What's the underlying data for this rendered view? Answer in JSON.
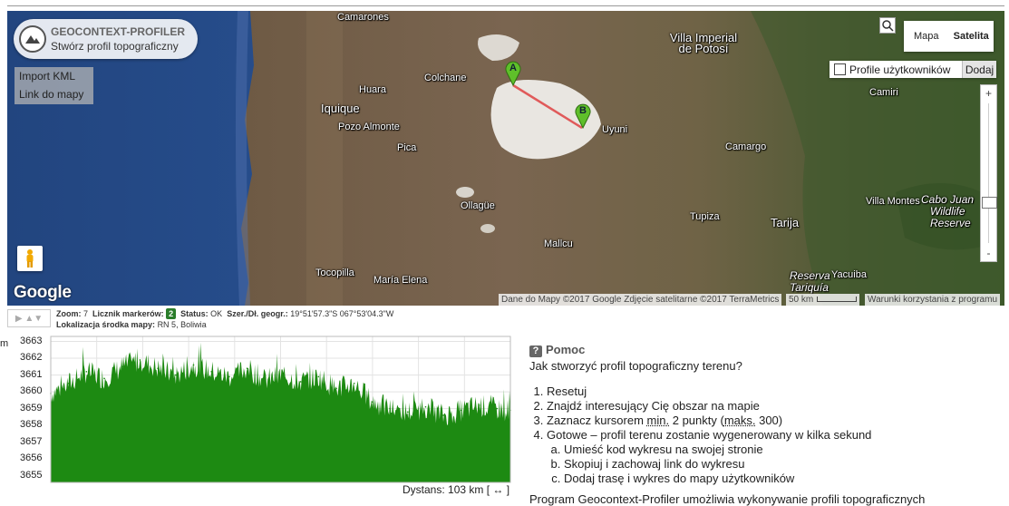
{
  "app": {
    "title": "GEOCONTEXT-PROFILER",
    "subtitle": "Stwórz profil topograficzny"
  },
  "side_links": [
    "Import KML",
    "Link do mapy"
  ],
  "map_type": {
    "map_label": "Mapa",
    "satellite_label": "Satelita",
    "selected": "Satelita"
  },
  "user_profiles": {
    "label": "Profile użytkowników",
    "add_label": "Dodaj",
    "checked": false
  },
  "zoom_controls": {
    "plus": "+",
    "minus": "-",
    "level_fraction": 0.78
  },
  "places": [
    {
      "name": "Camarones",
      "kind": "normal"
    },
    {
      "name": "Villa Imperial de Potosí",
      "kind": "big"
    },
    {
      "name": "Colchane",
      "kind": "normal"
    },
    {
      "name": "Huara",
      "kind": "normal"
    },
    {
      "name": "Iquique",
      "kind": "big"
    },
    {
      "name": "Pozo Almonte",
      "kind": "normal"
    },
    {
      "name": "Pica",
      "kind": "normal"
    },
    {
      "name": "Uyuni",
      "kind": "normal"
    },
    {
      "name": "Camiri",
      "kind": "normal"
    },
    {
      "name": "Camargo",
      "kind": "normal"
    },
    {
      "name": "Ollagüe",
      "kind": "normal"
    },
    {
      "name": "Villa Montes",
      "kind": "normal"
    },
    {
      "name": "Cabo Juan",
      "kind": "italic"
    },
    {
      "name": "Wildlife",
      "kind": "italic"
    },
    {
      "name": "Reserve",
      "kind": "italic"
    },
    {
      "name": "Tupiza",
      "kind": "normal"
    },
    {
      "name": "Tarija",
      "kind": "big"
    },
    {
      "name": "Mallcu",
      "kind": "normal"
    },
    {
      "name": "Tocopilla",
      "kind": "normal"
    },
    {
      "name": "María Elena",
      "kind": "normal"
    },
    {
      "name": "Reserva",
      "kind": "italic"
    },
    {
      "name": "Tariquía",
      "kind": "italic"
    },
    {
      "name": "Yacuiba",
      "kind": "normal"
    }
  ],
  "markers": [
    {
      "label": "A",
      "color": "#4caf1d"
    },
    {
      "label": "B",
      "color": "#4caf1d"
    }
  ],
  "google_logo": "Google",
  "attribution": {
    "data": "Dane do Mapy ©2017 Google Zdjęcie satelitarne ©2017 TerraMetrics",
    "scale": "50 km",
    "terms": "Warunki korzystania z programu"
  },
  "status": {
    "nav": "▶ ▲▼",
    "zoom_label": "Zoom:",
    "zoom_value": "7",
    "markers_label": "Licznik markerów:",
    "markers_value": "2",
    "status_label": "Status:",
    "status_value": "OK",
    "coords_label": "Szer./Dł. geogr.:",
    "coords_value": "19°51'57.3\"S 067°53'04.3\"W",
    "center_label": "Lokalizacja środka mapy:",
    "center_value": "RN 5, Boliwia"
  },
  "chart_data": {
    "type": "area",
    "ylabel": "m",
    "ylim": [
      3654.6,
      3663.3
    ],
    "yticks": [
      3655,
      3656,
      3657,
      3658,
      3659,
      3660,
      3661,
      3662,
      3663
    ],
    "xlim": [
      0,
      103
    ],
    "xlabel": "Dystans: 103 km [ ↔ ]",
    "color": "#1d8a12",
    "series": [
      {
        "x": [
          0,
          4,
          8,
          12,
          16,
          20,
          24,
          28,
          32,
          36,
          40,
          44,
          48,
          52,
          56,
          60,
          64,
          68,
          72,
          76,
          80,
          84,
          88,
          92,
          96,
          100,
          103
        ],
        "values": [
          3659.9,
          3660.5,
          3661.2,
          3660.8,
          3661.5,
          3661.9,
          3661.4,
          3661.0,
          3661.6,
          3661.2,
          3660.9,
          3661.4,
          3660.7,
          3661.0,
          3660.6,
          3660.9,
          3660.2,
          3660.5,
          3659.4,
          3659.0,
          3658.8,
          3659.1,
          3658.6,
          3658.9,
          3659.2,
          3659.0,
          3658.9
        ]
      }
    ]
  },
  "help": {
    "title": "Pomoc",
    "question": "Jak stworzyć profil topograficzny terenu?",
    "steps": [
      "Resetuj",
      "Znajdź interesujący Cię obszar na mapie",
      "Zaznacz kursorem min. 2 punkty (maks. 300)",
      "Gotowe – profil terenu zostanie wygenerowany w kilka sekund"
    ],
    "step3_parts": [
      "Zaznacz kursorem ",
      "min.",
      " 2 punkty (",
      "maks.",
      " 300)"
    ],
    "substeps": [
      "Umieść kod wykresu na swojej stronie",
      "Skopiuj i zachowaj link do wykresu",
      "Dodaj trasę i wykres do mapy użytkowników"
    ],
    "footer": "Program Geocontext-Profiler umożliwia wykonywanie profili topograficznych"
  }
}
